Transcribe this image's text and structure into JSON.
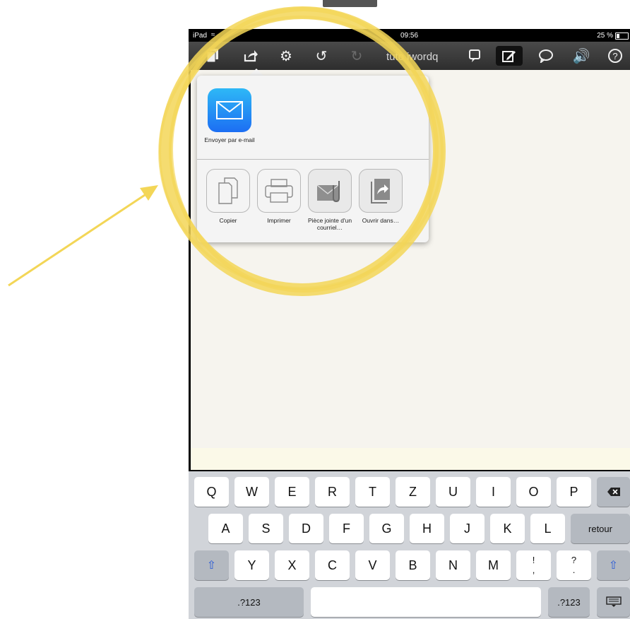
{
  "status_bar": {
    "device": "iPad",
    "time": "09:56",
    "battery": "25 %"
  },
  "toolbar": {
    "title": "tuto iwordq",
    "icons": [
      "documents-icon",
      "share-icon",
      "settings-icon",
      "undo-icon",
      "redo-icon",
      "prediction-icon",
      "edit-icon",
      "speech-bubble-icon",
      "speaker-icon",
      "help-icon"
    ],
    "help_label": "?"
  },
  "share_menu": {
    "top_items": [
      {
        "label": "Envoyer par e-mail",
        "icon": "mail-icon"
      }
    ],
    "action_items": [
      {
        "label": "Copier",
        "icon": "copy-icon"
      },
      {
        "label": "Imprimer",
        "icon": "print-icon"
      },
      {
        "label": "Pièce jointe d'un courriel…",
        "icon": "attachment-icon"
      },
      {
        "label": "Ouvrir dans…",
        "icon": "open-in-icon"
      }
    ]
  },
  "keyboard": {
    "row1": [
      "Q",
      "W",
      "E",
      "R",
      "T",
      "Z",
      "U",
      "I",
      "O",
      "P"
    ],
    "row2": [
      "A",
      "S",
      "D",
      "F",
      "G",
      "H",
      "J",
      "K",
      "L"
    ],
    "row3": [
      "Y",
      "X",
      "C",
      "V",
      "B",
      "N",
      "M"
    ],
    "return_label": "retour",
    "numbers_label": ".?123",
    "punct1_top": "!",
    "punct1_bottom": ",",
    "punct2_top": "?",
    "punct2_bottom": "."
  },
  "annotation": {
    "highlight_color": "#f3d657"
  }
}
